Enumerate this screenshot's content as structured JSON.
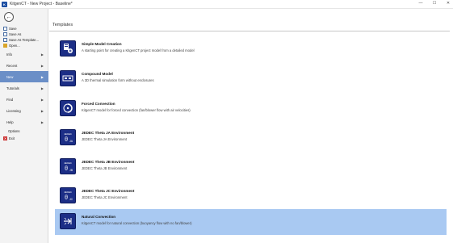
{
  "window": {
    "title": "KitgenCT - New Project - Baseline*",
    "app_icon_letter": "K",
    "minimize": "—",
    "maximize": "☐",
    "close": "✕"
  },
  "sidebar": {
    "back_glyph": "←",
    "items": [
      {
        "label": "Save"
      },
      {
        "label": "Save As"
      },
      {
        "label": "Save As Template..."
      },
      {
        "label": "Open..."
      },
      {
        "label": "Info"
      },
      {
        "label": "Recent"
      },
      {
        "label": "New"
      },
      {
        "label": "Tutorials"
      },
      {
        "label": "Find"
      },
      {
        "label": "Licensing"
      },
      {
        "label": "Help"
      },
      {
        "label": "Options"
      },
      {
        "label": "Exit"
      }
    ]
  },
  "main": {
    "section_title": "Templates",
    "templates": [
      {
        "name": "Simple Model Creation",
        "description": "A starting point for creating a KitgenCT project model from a detailed model",
        "icon": "model-creation-icon"
      },
      {
        "name": "Compound Model",
        "description": "A 3D thermal simulation form without enclosures",
        "icon": "compound-model-icon"
      },
      {
        "name": "Forced Convection",
        "description": "KitgenCT model for forced convection (fan/blower flow with air velocities)",
        "icon": "forced-convection-icon"
      },
      {
        "name": "JEDEC Theta JA Environment",
        "description": "JEDEC Theta JA Environment",
        "icon": "theta-ja-icon",
        "sub": "JA"
      },
      {
        "name": "JEDEC Theta JB Environment",
        "description": "JEDEC Theta JB Environment",
        "icon": "theta-jb-icon",
        "sub": "JB"
      },
      {
        "name": "JEDEC Theta JC Environment",
        "description": "JEDEC Theta JC Environment",
        "icon": "theta-jc-icon",
        "sub": "JC"
      },
      {
        "name": "Natural Convection",
        "description": "KitgenCT model for natural convection (buoyancy flow with no fan/blower)",
        "icon": "natural-convection-icon"
      }
    ],
    "selected_index": 6
  },
  "colors": {
    "selected_row": "#a9c9f2",
    "active_menu": "#6b8fc7",
    "icon_bg": "#1c2e86"
  }
}
